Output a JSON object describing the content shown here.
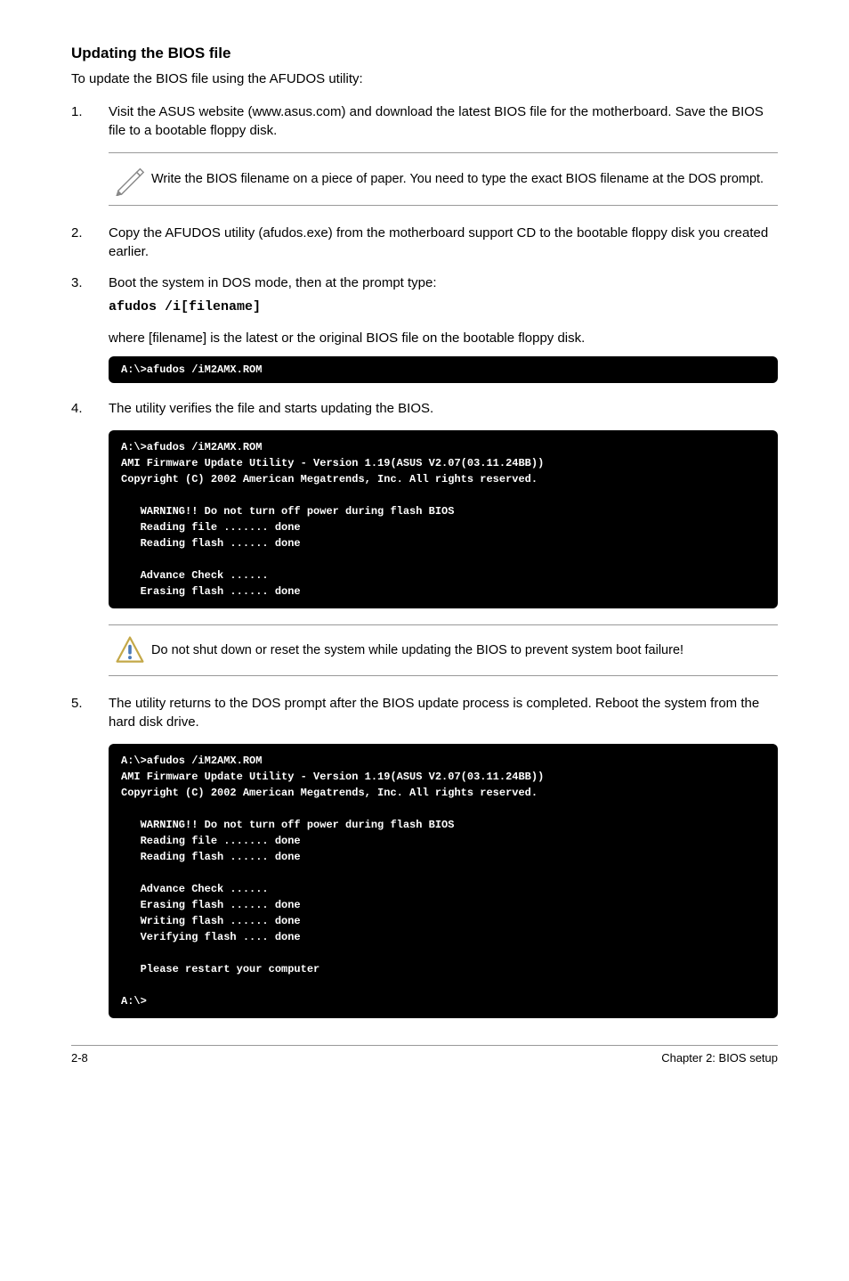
{
  "heading": "Updating the BIOS file",
  "intro": "To update the BIOS file using the AFUDOS utility:",
  "step1": {
    "num": "1.",
    "text": "Visit the ASUS website (www.asus.com) and download the latest BIOS file for the motherboard. Save the BIOS file to a bootable floppy disk."
  },
  "note1": "Write the BIOS filename on a piece of paper. You need to type the exact BIOS filename at the DOS prompt.",
  "step2": {
    "num": "2.",
    "text": "Copy the AFUDOS utility (afudos.exe) from the motherboard support CD to the bootable floppy disk you created earlier."
  },
  "step3": {
    "num": "3.",
    "text": "Boot the system in DOS mode, then at the prompt type:",
    "command": "afudos /i[filename]"
  },
  "subtext3": "where [filename] is the latest or the original BIOS file on the bootable floppy disk.",
  "terminal1": "A:\\>afudos /iM2AMX.ROM",
  "step4": {
    "num": "4.",
    "text": "The utility verifies the file and starts updating the BIOS."
  },
  "terminal2": "A:\\>afudos /iM2AMX.ROM\nAMI Firmware Update Utility - Version 1.19(ASUS V2.07(03.11.24BB))\nCopyright (C) 2002 American Megatrends, Inc. All rights reserved.\n\n   WARNING!! Do not turn off power during flash BIOS\n   Reading file ....... done\n   Reading flash ...... done\n\n   Advance Check ......\n   Erasing flash ...... done",
  "warning1": "Do not shut down or reset the system while updating the BIOS to prevent system boot failure!",
  "step5": {
    "num": "5.",
    "text": "The utility returns to the DOS prompt after the BIOS update process is completed. Reboot the system from the hard disk drive."
  },
  "terminal3": "A:\\>afudos /iM2AMX.ROM\nAMI Firmware Update Utility - Version 1.19(ASUS V2.07(03.11.24BB))\nCopyright (C) 2002 American Megatrends, Inc. All rights reserved.\n\n   WARNING!! Do not turn off power during flash BIOS\n   Reading file ....... done\n   Reading flash ...... done\n\n   Advance Check ......\n   Erasing flash ...... done\n   Writing flash ...... done\n   Verifying flash .... done\n\n   Please restart your computer\n\nA:\\>",
  "footer": {
    "left": "2-8",
    "right": "Chapter 2: BIOS setup"
  }
}
